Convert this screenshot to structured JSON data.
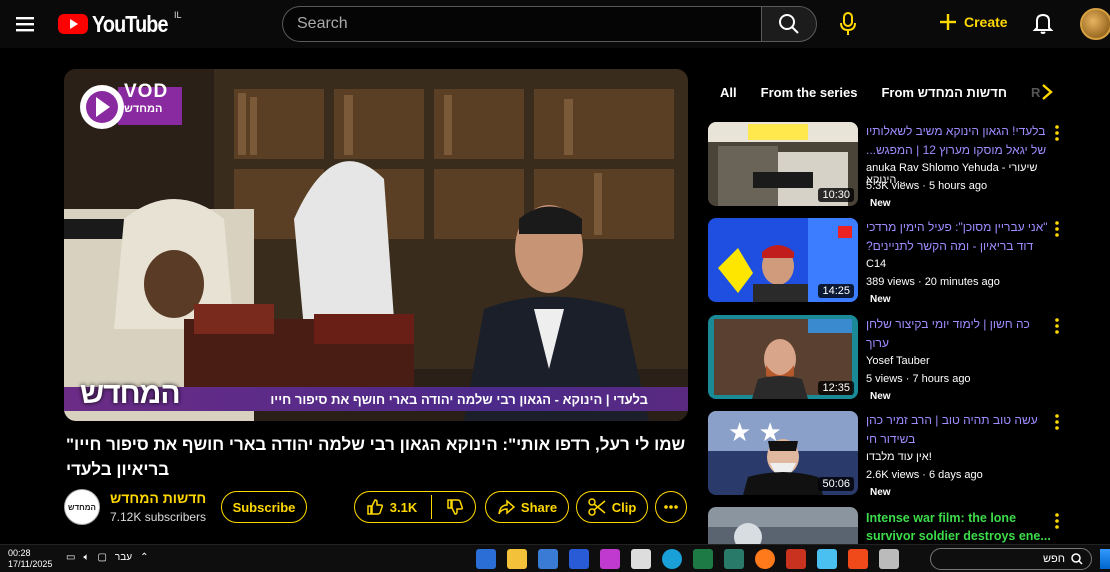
{
  "header": {
    "logo_text": "YouTube",
    "logo_region": "IL",
    "search_placeholder": "Search",
    "create_label": "Create"
  },
  "player": {
    "badge_text": "VOD",
    "badge_sub": "המחדש",
    "ticker_text": "בלעדי | הינוקא - הגאון רבי שלמה יהודה בארי חושף את סיפור חייו",
    "ticker_logo": "המחדש"
  },
  "video": {
    "title": "שמו לי רעל, רדפו אותי\": הינוקא הגאון רבי שלמה יהודה בארי חושף את סיפור חייו\" בריאיון בלעדי"
  },
  "channel": {
    "avatar_text": "המחדש",
    "name": "חדשות המחדש",
    "subscribers": "7.12K subscribers",
    "subscribe_label": "Subscribe",
    "like_count": "3.1K",
    "share_label": "Share",
    "clip_label": "Clip"
  },
  "chips": [
    "All",
    "From the series",
    "From חדשות המחדש",
    "R"
  ],
  "recommendations": [
    {
      "title_line1": "בלעדי! הגאון הינוקא משיב לשאלותיו",
      "title_line2": "של יגאל מוסקו מערוץ 12 | המפגש...",
      "channel": "anuka Rav Shlomo Yehuda - שיעורי הינוקא...",
      "meta": "5.3K views · 5 hours ago",
      "badge": "New",
      "duration": "10:30"
    },
    {
      "title_line1": "\"אני עבריין מסוכן\": פעיל הימין מרדכי",
      "title_line2": "דוד בריאיון - ומה הקשר לתניינים?",
      "channel": "C14",
      "meta": "389 views · 20 minutes ago",
      "badge": "New",
      "duration": "14:25"
    },
    {
      "title_line1": "כה חשון | לימוד יומי בקיצור שלחן",
      "title_line2": "ערוך",
      "channel": "Yosef Tauber",
      "meta": "5 views · 7 hours ago",
      "badge": "New",
      "duration": "12:35"
    },
    {
      "title_line1": "עשה טוב תהיה טוב | הרב זמיר כהן",
      "title_line2": "בשידור חי",
      "channel": "אין עוד מלבדו!",
      "meta": "2.6K views · 6 days ago",
      "badge": "New",
      "duration": "50:06"
    },
    {
      "title_line1": "Intense war film: the lone",
      "title_line2": "survivor soldier destroys ene...",
      "channel": "",
      "meta": "",
      "badge": "",
      "duration": ""
    }
  ],
  "taskbar": {
    "time": "00:28",
    "date": "17/11/2025",
    "lang": "עבר",
    "search_text": "חפש"
  },
  "colors": {
    "accent": "#ffd800",
    "title_link": "#a08cff",
    "green_title": "#3ddc4a"
  }
}
